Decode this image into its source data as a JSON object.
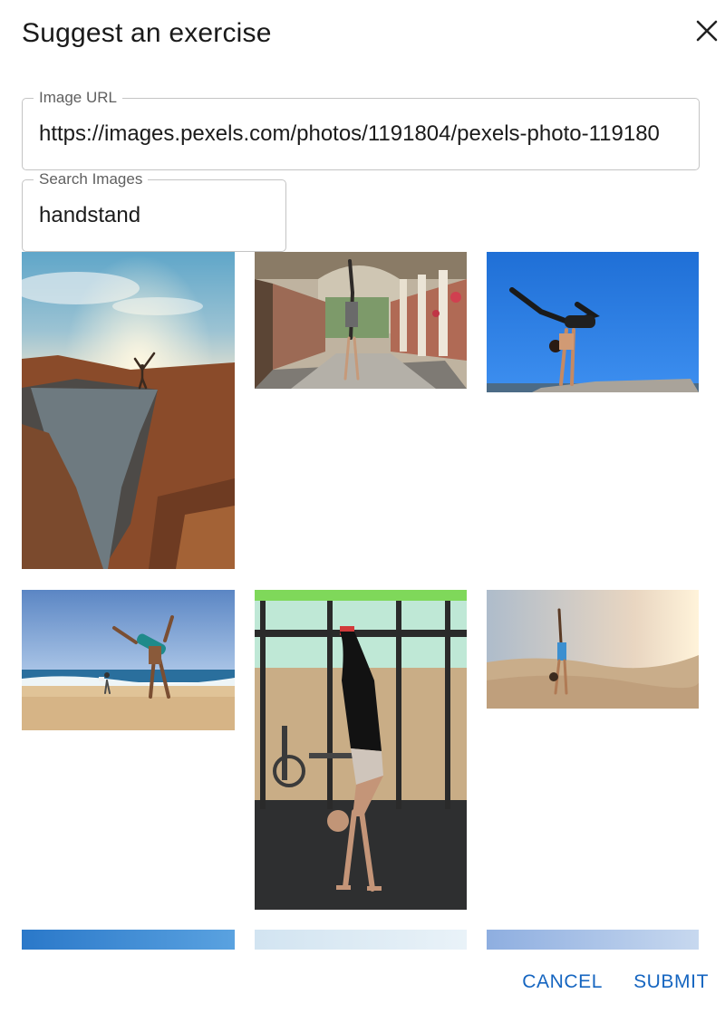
{
  "dialog": {
    "title": "Suggest an exercise"
  },
  "fields": {
    "image_url": {
      "label": "Image URL",
      "value": "https://images.pexels.com/photos/1191804/pexels-photo-119180"
    },
    "search": {
      "label": "Search Images",
      "value": "handstand"
    }
  },
  "results": [
    {
      "subject": "person-on-cliff-at-sunset"
    },
    {
      "subject": "handstand-in-arcade-corridor"
    },
    {
      "subject": "handstand-on-rock-blue-sky"
    },
    {
      "subject": "cartwheel-on-beach"
    },
    {
      "subject": "handstand-in-gym"
    },
    {
      "subject": "handstand-in-desert-dunes"
    },
    {
      "subject": "sky-image-partial"
    },
    {
      "subject": "sky-image-partial"
    },
    {
      "subject": "sky-image-partial"
    }
  ],
  "actions": {
    "cancel_label": "CANCEL",
    "submit_label": "SUBMIT"
  },
  "colors": {
    "accent": "#1565c0",
    "border": "#c4c4c4"
  }
}
